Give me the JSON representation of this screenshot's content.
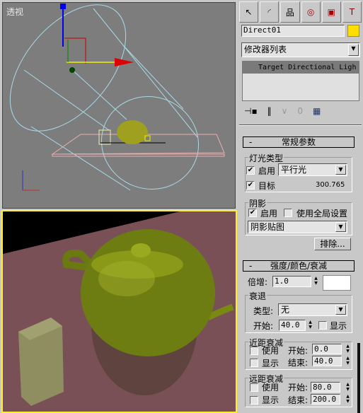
{
  "viewports": {
    "top": {
      "label": "透视"
    },
    "bottom": {
      "label": ""
    }
  },
  "command_panel": {
    "tabs": [
      {
        "name": "create",
        "icon": "cursor-star-icon"
      },
      {
        "name": "modify",
        "icon": "modify-arc-icon"
      },
      {
        "name": "hierarchy",
        "icon": "hierarchy-icon"
      },
      {
        "name": "motion",
        "icon": "motion-wheel-icon"
      },
      {
        "name": "display",
        "icon": "display-monitor-icon"
      },
      {
        "name": "utilities",
        "icon": "hammer-icon"
      }
    ],
    "object_name": "Direct01",
    "object_color": "#ffdd00",
    "modifier_list": "修改器列表",
    "stack_items": [
      "Target Directional Ligh"
    ],
    "general": {
      "title": "常规参数",
      "collapse": "-",
      "light_type_group": "灯光类型",
      "on_label": "启用",
      "on_checked": true,
      "type_value": "平行光",
      "target_label": "目标",
      "target_checked": true,
      "target_distance": "300.765",
      "shadows_group": "阴影",
      "shadow_on_label": "启用",
      "shadow_on_checked": true,
      "global_label": "使用全局设置",
      "global_checked": false,
      "shadow_type": "阴影贴图",
      "exclude_button": "排除..."
    },
    "intensity": {
      "title": "强度/颜色/衰减",
      "collapse": "-",
      "multiplier_label": "倍增:",
      "multiplier": "1.0",
      "color": "#ffffff",
      "decay_group": "衰退",
      "decay_type_label": "类型:",
      "decay_type": "无",
      "decay_start_label": "开始:",
      "decay_start": "40.0",
      "decay_show_label": "显示",
      "near_group": "近距衰减",
      "near_use": "使用",
      "near_show": "显示",
      "near_start_label": "开始:",
      "near_start": "0.0",
      "near_end_label": "结束:",
      "near_end": "40.0",
      "far_group": "远距衰减",
      "far_use": "使用",
      "far_show": "显示",
      "far_start_label": "开始:",
      "far_start": "80.0",
      "far_end_label": "结束:",
      "far_end": "200.0"
    }
  }
}
